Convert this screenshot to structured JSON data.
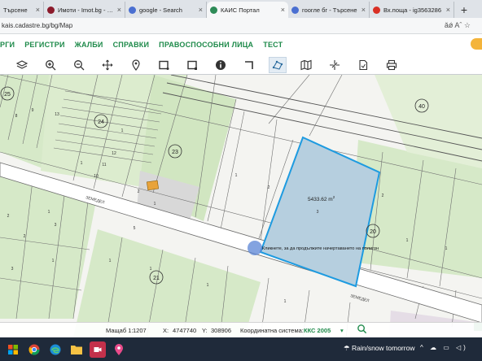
{
  "browser": {
    "tabs": [
      {
        "label": "Търсене",
        "color": "#5a8ed8"
      },
      {
        "label": "Имоти - Imot.bg - Пр",
        "color": "#8b1a2b"
      },
      {
        "label": "google - Search",
        "color": "#4a6fd1"
      },
      {
        "label": "КАИС Портал",
        "color": "#2e8b57"
      },
      {
        "label": "гоогле бг - Търсене",
        "color": "#4a6fd1"
      },
      {
        "label": "Вх.поща - ig3563286",
        "color": "#d93025"
      }
    ],
    "close_glyph": "×",
    "new_tab_glyph": "+",
    "url": "kais.cadastre.bg/bg/Map",
    "addr_icons": "ǎǿ  Aˆ  ☆"
  },
  "menu": {
    "items": [
      "РГИ",
      "РЕГИСТРИ",
      "ЖАЛБИ",
      "СПРАВКИ",
      "ПРАВОСПОСОБНИ ЛИЦА",
      "ТЕСТ"
    ]
  },
  "toolbar": {
    "tools": [
      "layers-icon",
      "zoom-in-icon",
      "zoom-out-icon",
      "pan-icon",
      "location-pin-icon",
      "draw-rectangle-icon",
      "select-rectangle-icon",
      "info-icon",
      "measure-line-icon",
      "draw-polygon-icon",
      "map-icon",
      "crosshair-icon",
      "document-icon",
      "print-icon"
    ],
    "active_index": 9
  },
  "map": {
    "polygon_area": "5433.62 m",
    "polygon_area_sup": "2",
    "tooltip": "Кликнете, за да продължите начертаването на полигон",
    "parcel_labels": [
      "25",
      "24",
      "23",
      "40",
      "20",
      "21",
      "1",
      "2",
      "3",
      "1",
      "2",
      "3",
      "1",
      "1",
      "1",
      "1",
      "1",
      "1",
      "2",
      "2",
      "1",
      "1",
      "1",
      "10",
      "11",
      "12",
      "13",
      "9",
      "8",
      "2",
      "3",
      "1",
      "5"
    ],
    "road_labels": [
      "ЗЕМЕДЕЛ",
      "ЗЕМЕДЕЛ"
    ],
    "highlight_color": "#1e9be0",
    "fill_color": "#b6cfdf"
  },
  "statusbar": {
    "scale_label": "Мащаб 1:",
    "scale_value": "1207",
    "x_label": "X:",
    "x_value": "4747740",
    "y_label": "Y:",
    "y_value": "308906",
    "crs_label": "Координатна система:",
    "crs_value": "ККС 2005",
    "crs_caret": "▾"
  },
  "taskbar": {
    "weather": "Rain/snow tomorrow",
    "tray": "^ ☁ ▭ ◁)"
  }
}
